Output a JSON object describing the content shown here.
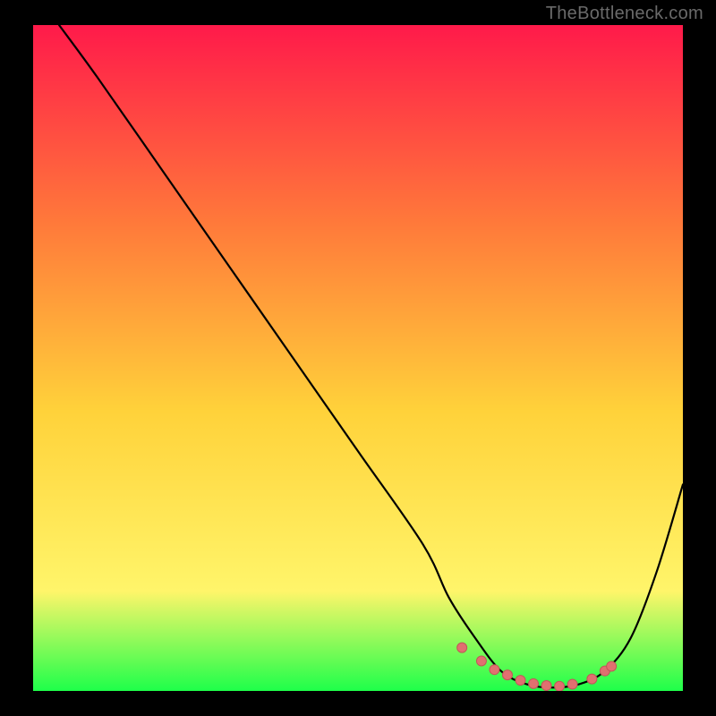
{
  "watermark": "TheBottleneck.com",
  "colors": {
    "gradient_top": "#ff1a4a",
    "gradient_mid1": "#ff7a3a",
    "gradient_mid2": "#ffd23a",
    "gradient_mid3": "#fff56a",
    "gradient_bottom": "#1eff4a",
    "curve": "#000000",
    "marker_fill": "#e07070",
    "marker_stroke": "#c05858",
    "frame": "#000000"
  },
  "chart_data": {
    "type": "line",
    "title": "",
    "xlabel": "",
    "ylabel": "",
    "xlim": [
      0,
      100
    ],
    "ylim": [
      0,
      100
    ],
    "series": [
      {
        "name": "bottleneck-curve",
        "x": [
          4,
          10,
          20,
          30,
          40,
          50,
          60,
          64,
          68,
          72,
          76,
          80,
          84,
          88,
          92,
          96,
          100
        ],
        "y": [
          100,
          92,
          78,
          64,
          50,
          36,
          22,
          14,
          8,
          3,
          1,
          0.5,
          1,
          3,
          8,
          18,
          31
        ]
      }
    ],
    "markers": {
      "name": "highlight-segment",
      "x": [
        66,
        69,
        71,
        73,
        75,
        77,
        79,
        81,
        83,
        86,
        88,
        89
      ],
      "y": [
        6.5,
        4.5,
        3.2,
        2.4,
        1.6,
        1.1,
        0.8,
        0.7,
        1.0,
        1.8,
        3.0,
        3.7
      ]
    }
  }
}
